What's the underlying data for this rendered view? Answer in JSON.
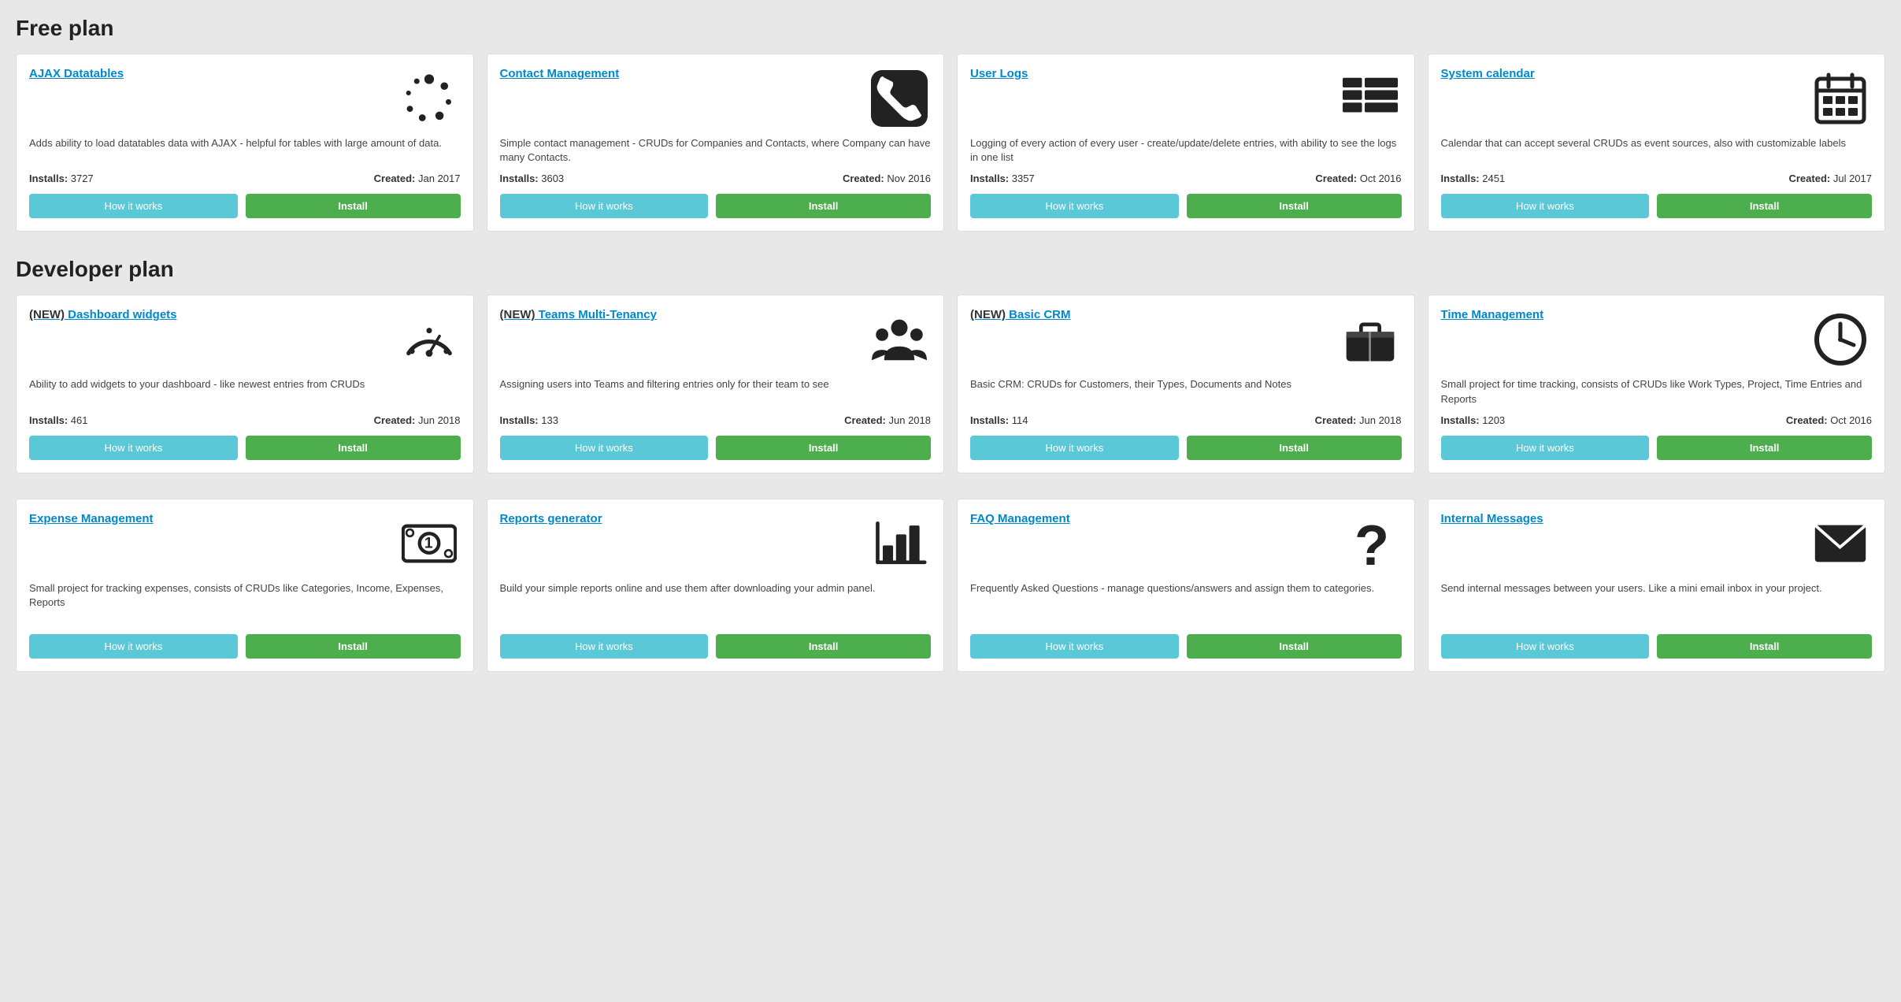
{
  "freePlan": {
    "sectionTitle": "Free plan",
    "cards": [
      {
        "id": "ajax-datatables",
        "isNew": false,
        "title": "AJAX Datatables",
        "description": "Adds ability to load datatables data with AJAX - helpful for tables with large amount of data.",
        "installs": "3727",
        "created": "Jan 2017",
        "howLabel": "How it works",
        "installLabel": "Install",
        "iconType": "spinner"
      },
      {
        "id": "contact-management",
        "isNew": false,
        "title": "Contact Management",
        "description": "Simple contact management - CRUDs for Companies and Contacts, where Company can have many Contacts.",
        "installs": "3603",
        "created": "Nov 2016",
        "howLabel": "How it works",
        "installLabel": "Install",
        "iconType": "phone"
      },
      {
        "id": "user-logs",
        "isNew": false,
        "title": "User Logs",
        "description": "Logging of every action of every user - create/update/delete entries, with ability to see the logs in one list",
        "installs": "3357",
        "created": "Oct 2016",
        "howLabel": "How it works",
        "installLabel": "Install",
        "iconType": "table"
      },
      {
        "id": "system-calendar",
        "isNew": false,
        "title": "System calendar",
        "description": "Calendar that can accept several CRUDs as event sources, also with customizable labels",
        "installs": "2451",
        "created": "Jul 2017",
        "howLabel": "How it works",
        "installLabel": "Install",
        "iconType": "calendar"
      }
    ]
  },
  "developerPlan": {
    "sectionTitle": "Developer plan",
    "cards": [
      {
        "id": "dashboard-widgets",
        "isNew": true,
        "title": "Dashboard widgets",
        "description": "Ability to add widgets to your dashboard - like newest entries from CRUDs",
        "installs": "461",
        "created": "Jun 2018",
        "howLabel": "How it works",
        "installLabel": "Install",
        "iconType": "gauge"
      },
      {
        "id": "teams-multi-tenancy",
        "isNew": true,
        "title": "Teams Multi-Tenancy",
        "description": "Assigning users into Teams and filtering entries only for their team to see",
        "installs": "133",
        "created": "Jun 2018",
        "howLabel": "How it works",
        "installLabel": "Install",
        "iconType": "team"
      },
      {
        "id": "basic-crm",
        "isNew": true,
        "title": "Basic CRM",
        "description": "Basic CRM: CRUDs for Customers, their Types, Documents and Notes",
        "installs": "114",
        "created": "Jun 2018",
        "howLabel": "How it works",
        "installLabel": "Install",
        "iconType": "briefcase"
      },
      {
        "id": "time-management",
        "isNew": false,
        "title": "Time Management",
        "description": "Small project for time tracking, consists of CRUDs like Work Types, Project, Time Entries and Reports",
        "installs": "1203",
        "created": "Oct 2016",
        "howLabel": "How it works",
        "installLabel": "Install",
        "iconType": "clock"
      }
    ]
  },
  "bottomCards": [
    {
      "id": "expense-management",
      "isNew": false,
      "title": "Expense Management",
      "description": "Small project for tracking expenses, consists of CRUDs like Categories, Income, Expenses, Reports",
      "howLabel": "How it works",
      "installLabel": "Install",
      "iconType": "money"
    },
    {
      "id": "reports-generator",
      "isNew": false,
      "title": "Reports generator",
      "description": "Build your simple reports online and use them after downloading your admin panel.",
      "howLabel": "How it works",
      "installLabel": "Install",
      "iconType": "chart"
    },
    {
      "id": "faq-management",
      "isNew": false,
      "title": "FAQ Management",
      "description": "Frequently Asked Questions - manage questions/answers and assign them to categories.",
      "howLabel": "How it works",
      "installLabel": "Install",
      "iconType": "question"
    },
    {
      "id": "internal-messages",
      "isNew": false,
      "title": "Internal Messages",
      "description": "Send internal messages between your users. Like a mini email inbox in your project.",
      "howLabel": "How it works",
      "installLabel": "Install",
      "iconType": "envelope"
    }
  ]
}
